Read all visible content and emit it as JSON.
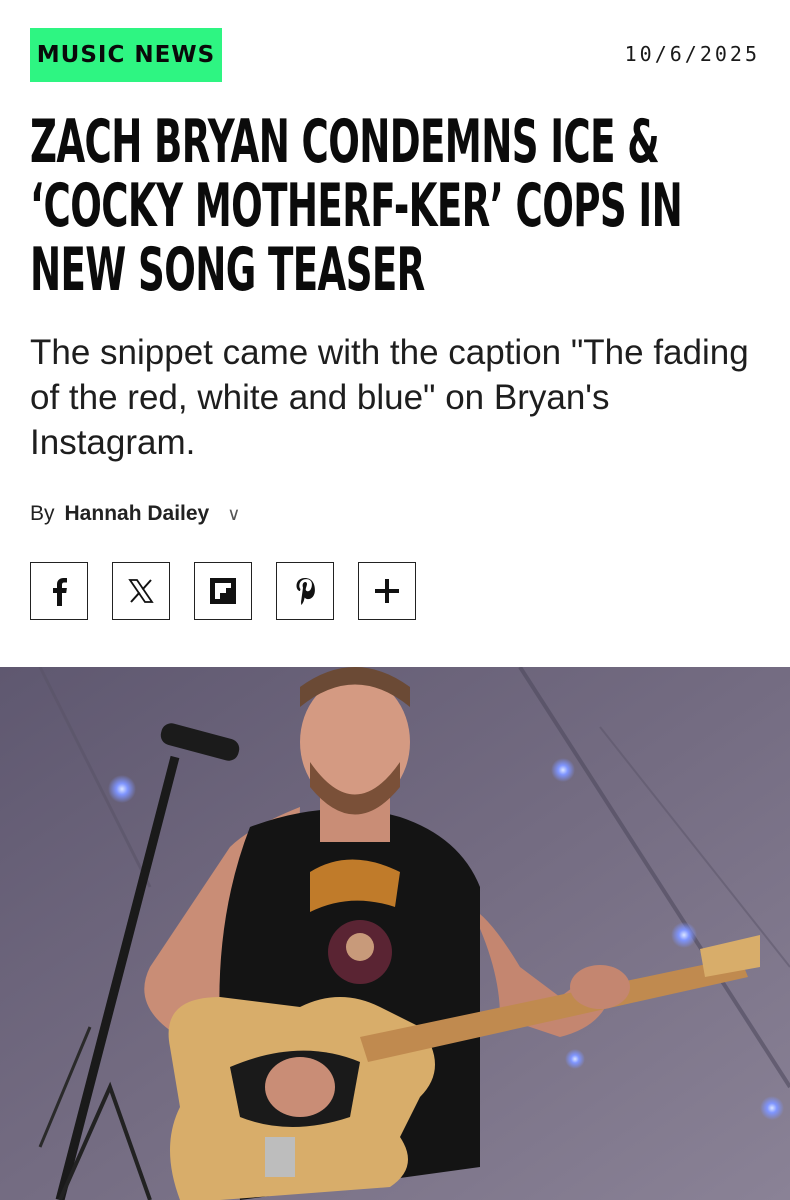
{
  "section": {
    "label": "MUSIC NEWS"
  },
  "date": "10/6/2025",
  "headline": "ZACH BRYAN CONDEMNS ICE & ‘COCKY MOTHERF-KER’ COPS IN NEW SONG TEASER",
  "dek": "The snippet came with the caption \"The fading of the red, white and blue\" on Bryan's Instagram.",
  "byline": {
    "prefix": "By",
    "author": "Hannah Dailey",
    "chevron": "∨"
  },
  "share": [
    {
      "name": "facebook-icon",
      "glyph": "f"
    },
    {
      "name": "x-icon",
      "glyph": "𝕏"
    },
    {
      "name": "flipboard-icon",
      "glyph": ""
    },
    {
      "name": "pinterest-icon",
      "glyph": "p"
    },
    {
      "name": "more-icon",
      "glyph": "+"
    }
  ],
  "colors": {
    "accent": "#2ef582",
    "text": "#111111",
    "photo_bg": "#6b6476"
  }
}
